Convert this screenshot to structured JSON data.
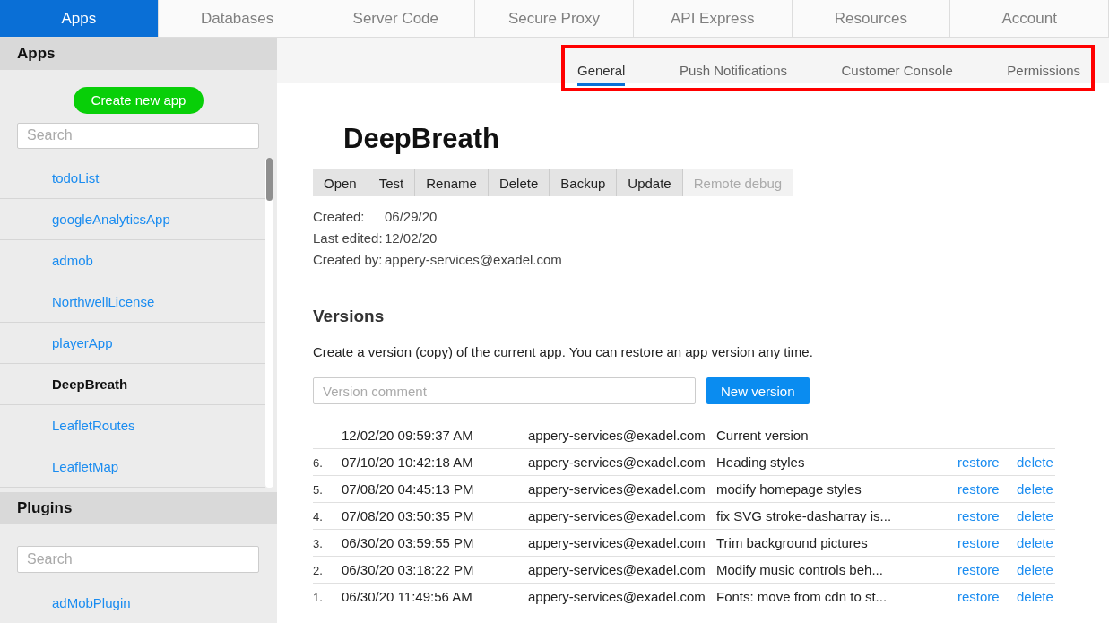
{
  "top_tabs": [
    {
      "label": "Apps",
      "selected": true
    },
    {
      "label": "Databases",
      "selected": false
    },
    {
      "label": "Server Code",
      "selected": false
    },
    {
      "label": "Secure Proxy",
      "selected": false
    },
    {
      "label": "API Express",
      "selected": false
    },
    {
      "label": "Resources",
      "selected": false
    },
    {
      "label": "Account",
      "selected": false
    }
  ],
  "sidebar": {
    "apps_title": "Apps",
    "create_button": "Create new app",
    "apps_search": {
      "placeholder": "Search"
    },
    "apps": [
      {
        "label": "todoList",
        "selected": false
      },
      {
        "label": "googleAnalyticsApp",
        "selected": false
      },
      {
        "label": "admob",
        "selected": false
      },
      {
        "label": "NorthwellLicense",
        "selected": false
      },
      {
        "label": "playerApp",
        "selected": false
      },
      {
        "label": "DeepBreath",
        "selected": true
      },
      {
        "label": "LeafletRoutes",
        "selected": false
      },
      {
        "label": "LeafletMap",
        "selected": false
      }
    ],
    "plugins_title": "Plugins",
    "plugins_search": {
      "placeholder": "Search"
    },
    "plugins": [
      {
        "label": "adMobPlugin"
      }
    ]
  },
  "sub_tabs": [
    {
      "label": "General",
      "selected": true
    },
    {
      "label": "Push Notifications",
      "selected": false
    },
    {
      "label": "Customer Console",
      "selected": false
    },
    {
      "label": "Permissions",
      "selected": false
    }
  ],
  "app_title": "DeepBreath",
  "actions": [
    {
      "label": "Open",
      "disabled": false
    },
    {
      "label": "Test",
      "disabled": false
    },
    {
      "label": "Rename",
      "disabled": false
    },
    {
      "label": "Delete",
      "disabled": false
    },
    {
      "label": "Backup",
      "disabled": false
    },
    {
      "label": "Update",
      "disabled": false
    },
    {
      "label": "Remote debug",
      "disabled": true
    }
  ],
  "meta": [
    {
      "label": "Created:",
      "value": "06/29/20"
    },
    {
      "label": "Last edited:",
      "value": "12/02/20"
    },
    {
      "label": "Created by:",
      "value": "appery-services@exadel.com"
    }
  ],
  "versions": {
    "title": "Versions",
    "description": "Create a version (copy) of the current app. You can restore an app version any time.",
    "comment_field": {
      "placeholder": "Version comment"
    },
    "new_button": "New version",
    "rows": [
      {
        "date": "12/02/20 09:59:37 AM",
        "user": "appery-services@exadel.com",
        "comment": "Current version"
      },
      {
        "number": "6.",
        "date": "07/10/20 10:42:18 AM",
        "user": "appery-services@exadel.com",
        "comment": "Heading styles",
        "restore": "restore",
        "delete": "delete"
      },
      {
        "number": "5.",
        "date": "07/08/20 04:45:13 PM",
        "user": "appery-services@exadel.com",
        "comment": "modify homepage styles",
        "restore": "restore",
        "delete": "delete"
      },
      {
        "number": "4.",
        "date": "07/08/20 03:50:35 PM",
        "user": "appery-services@exadel.com",
        "comment": "fix SVG stroke-dasharray is...",
        "restore": "restore",
        "delete": "delete"
      },
      {
        "number": "3.",
        "date": "06/30/20 03:59:55 PM",
        "user": "appery-services@exadel.com",
        "comment": "Trim background pictures",
        "restore": "restore",
        "delete": "delete"
      },
      {
        "number": "2.",
        "date": "06/30/20 03:18:22 PM",
        "user": "appery-services@exadel.com",
        "comment": "Modify music controls beh...",
        "restore": "restore",
        "delete": "delete"
      },
      {
        "number": "1.",
        "date": "06/30/20 11:49:56 AM",
        "user": "appery-services@exadel.com",
        "comment": "Fonts: move from cdn to st...",
        "restore": "restore",
        "delete": "delete"
      }
    ]
  }
}
